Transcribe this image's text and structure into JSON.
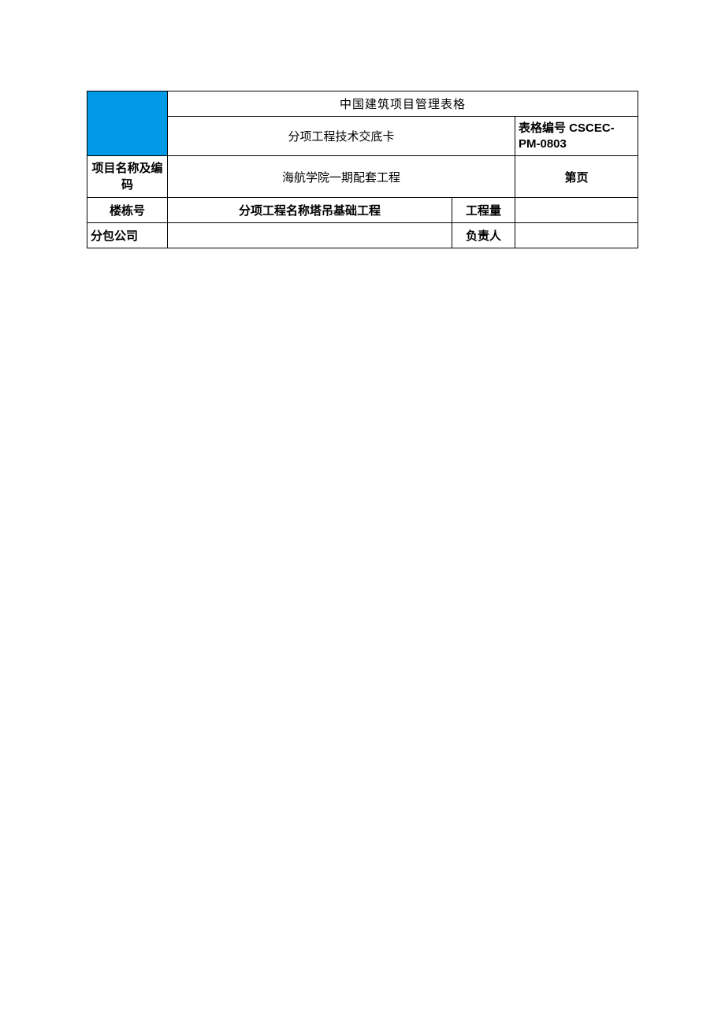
{
  "header": {
    "title": "中国建筑项目管理表格",
    "subtitle": "分项工程技术交底卡",
    "form_number": "表格编号 CSCEC-PM-0803"
  },
  "rows": {
    "project_label": "项目名称及编码",
    "project_value": "海航学院一期配套工程",
    "page_label": "第页",
    "building_label": "楼栋号",
    "subitem_text": "分项工程名称塔吊基础工程",
    "quantity_label": "工程量",
    "subcontractor_label": "分包公司",
    "responsible_label": "负责人"
  }
}
